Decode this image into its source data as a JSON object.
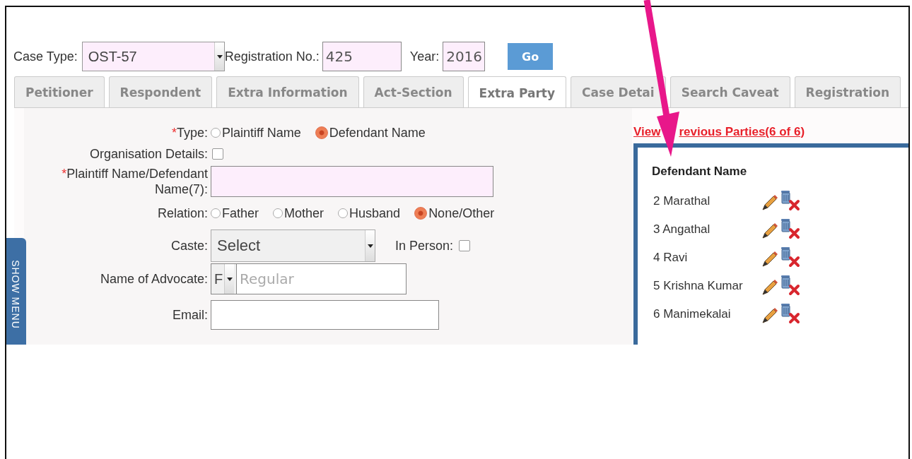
{
  "header": {
    "case_type": {
      "label": "Case Type:",
      "value": "OST-57"
    },
    "registration": {
      "label": "Registration No.:",
      "value": "425"
    },
    "year": {
      "label": "Year:",
      "value": "2016"
    },
    "go_button": "Go"
  },
  "tabs": [
    {
      "label": "Petitioner",
      "selected": false
    },
    {
      "label": "Respondent",
      "selected": false
    },
    {
      "label": "Extra Information",
      "selected": false
    },
    {
      "label": "Act-Section",
      "selected": false
    },
    {
      "label": "Extra Party",
      "selected": true
    },
    {
      "label": "Case Detai",
      "selected": false
    },
    {
      "label": "Search Caveat",
      "selected": false
    },
    {
      "label": "Registration",
      "selected": false
    }
  ],
  "side_menu": "SHOW MENU",
  "form": {
    "type": {
      "required_mark": "*",
      "label": "Type:",
      "options": [
        {
          "label": "Plaintiff Name",
          "selected": false
        },
        {
          "label": "Defendant Name",
          "selected": true
        }
      ]
    },
    "organisation": {
      "label": "Organisation Details:",
      "checked": false
    },
    "name": {
      "required_mark": "*",
      "label": "Plaintiff Name/Defendant Name(7):"
    },
    "relation": {
      "label": "Relation:",
      "options": [
        {
          "label": "Father",
          "selected": false
        },
        {
          "label": "Mother",
          "selected": false
        },
        {
          "label": "Husband",
          "selected": false
        },
        {
          "label": "None/Other",
          "selected": true
        }
      ]
    },
    "caste": {
      "label": "Caste:",
      "value": "Select"
    },
    "in_person": {
      "label": "In Person:",
      "checked": false
    },
    "advocate": {
      "label": "Name of Advocate:",
      "type_value": "F",
      "placeholder": "Regular"
    },
    "email": {
      "label": "Email:"
    }
  },
  "previous_parties": {
    "link_parts": [
      "View",
      "revious Parties(6 of 6)"
    ],
    "heading": "Defendant Name",
    "parties": [
      "2 Marathal",
      "3 Angathal",
      "4 Ravi",
      "5 Krishna Kumar",
      "6 Manimekalai"
    ]
  }
}
